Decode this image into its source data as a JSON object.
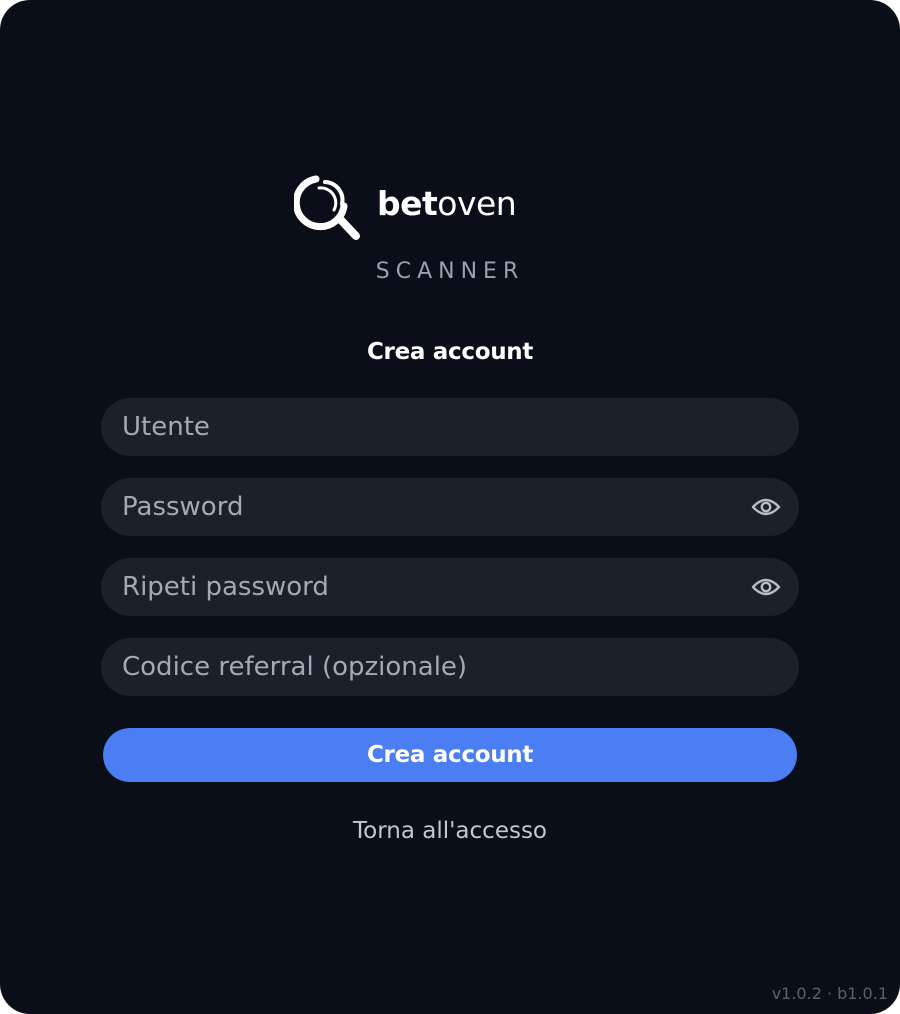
{
  "brand": {
    "name_bold": "bet",
    "name_light": "oven",
    "subtitle": "SCANNER",
    "logo_icon": "magnifier-logo-icon"
  },
  "form": {
    "heading": "Crea account",
    "username_placeholder": "Utente",
    "password_placeholder": "Password",
    "repeat_password_placeholder": "Ripeti password",
    "referral_placeholder": "Codice referral (opzionale)",
    "submit_label": "Crea account",
    "toggle_icon": "eye-icon"
  },
  "footer": {
    "back_link": "Torna all'accesso",
    "version": "v1.0.2 · b1.0.1"
  },
  "colors": {
    "background": "#0a0e19",
    "field": "#1b202b",
    "accent": "#4a7ef2",
    "text": "#ffffff",
    "muted": "#9aa1ad"
  }
}
